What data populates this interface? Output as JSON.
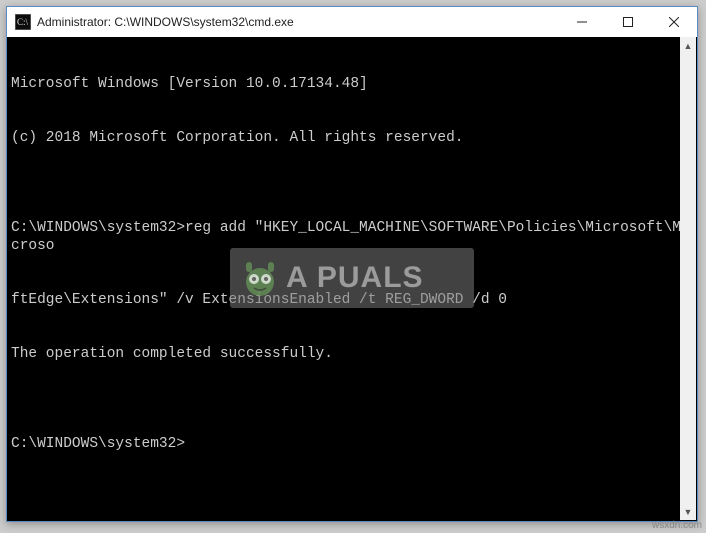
{
  "titlebar": {
    "title": "Administrator: C:\\WINDOWS\\system32\\cmd.exe"
  },
  "console": {
    "line1": "Microsoft Windows [Version 10.0.17134.48]",
    "line2": "(c) 2018 Microsoft Corporation. All rights reserved.",
    "blank1": "",
    "prompt1": "C:\\WINDOWS\\system32>",
    "command_part1": "reg add \"HKEY_LOCAL_MACHINE\\SOFTWARE\\Policies\\Microsoft\\Microso",
    "command_part2": "ftEdge\\Extensions\" /v ExtensionsEnabled /t REG_DWORD /d 0",
    "result": "The operation completed successfully.",
    "blank2": "",
    "prompt2": "C:\\WINDOWS\\system32>"
  },
  "watermark": {
    "text": "A PUALS"
  },
  "attribution": "wsxdn.com"
}
